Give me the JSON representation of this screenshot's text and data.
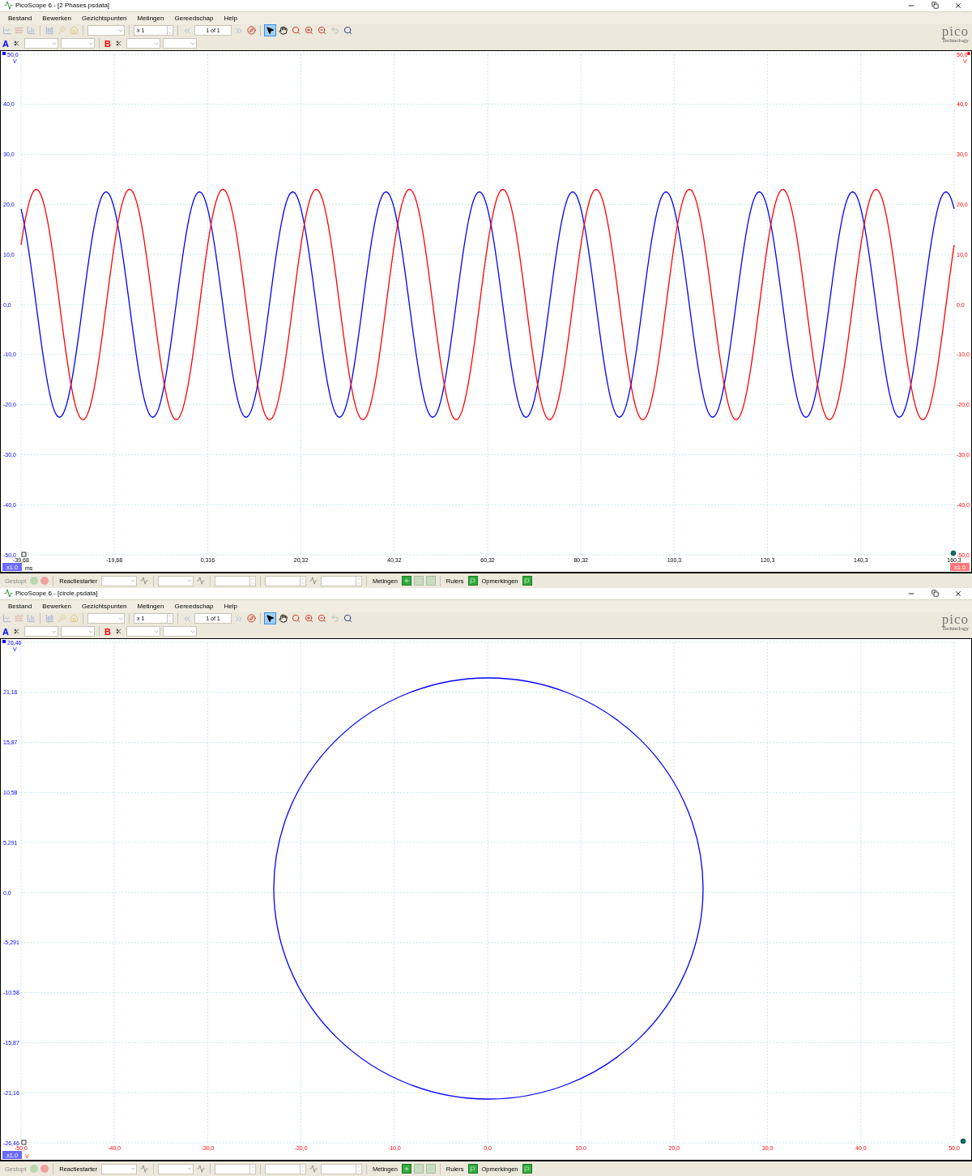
{
  "windows": [
    {
      "title": "PicoScope 6 - [2 Phases.psdata]",
      "menu": [
        "Bestand",
        "Bewerken",
        "Gezichtspunten",
        "Metingen",
        "Gereedschap",
        "Help"
      ],
      "toolbar": {
        "zoom": "x 1",
        "page": "1 of 1",
        "logo": "pico",
        "logo_sub": "Technology",
        "tools": [
          {
            "kind": "pointer",
            "selected": true
          },
          {
            "kind": "hand",
            "selected": false
          },
          {
            "kind": "zoom",
            "selected": false
          },
          {
            "kind": "zoom-in",
            "selected": false
          },
          {
            "kind": "zoom-out",
            "selected": false
          },
          {
            "kind": "undo",
            "selected": false
          },
          {
            "kind": "zoom-fit",
            "selected": false
          }
        ]
      },
      "channels": [
        {
          "label": "A",
          "color": "#0000ff"
        },
        {
          "label": "B",
          "color": "#ff0000"
        }
      ],
      "plot": {
        "kind": "time",
        "y_axis_left": {
          "unit": "V",
          "tag": "x1.0",
          "labels": [
            "50,0",
            "40,0",
            "30,0",
            "20,0",
            "10,0",
            "0,0",
            "-10,0",
            "-20,0",
            "-30,0",
            "-40,0",
            "-50,0"
          ]
        },
        "y_axis_right": {
          "unit": "V",
          "tag": "x1.0",
          "labels": [
            "50,0",
            "40,0",
            "30,0",
            "20,0",
            "10,0",
            "0,0",
            "-10,0",
            "-20,0",
            "-30,0",
            "-40,0",
            "-50,0"
          ]
        },
        "x_axis": {
          "unit": "ms",
          "labels": [
            "-39,68",
            "-19,68",
            "0,316",
            "20,32",
            "40,32",
            "60,32",
            "80,32",
            "100,3",
            "120,3",
            "140,3",
            "160,3"
          ]
        }
      },
      "status": {
        "state": "Gestopt",
        "trigger": "Reactiestarter",
        "measurements": "Metingen",
        "rulers": "Rulers",
        "notes": "Opmerkingen"
      }
    },
    {
      "title": "PicoScope 6 - [circle.psdata]",
      "menu": [
        "Bestand",
        "Bewerken",
        "Gezichtspunten",
        "Metingen",
        "Gereedschap",
        "Help"
      ],
      "toolbar": {
        "zoom": "x 1",
        "page": "1 of 1",
        "logo": "pico",
        "logo_sub": "Technology",
        "tools": [
          {
            "kind": "pointer",
            "selected": true
          },
          {
            "kind": "hand",
            "selected": false
          },
          {
            "kind": "zoom",
            "selected": false
          },
          {
            "kind": "zoom-in",
            "selected": false
          },
          {
            "kind": "zoom-out",
            "selected": false
          },
          {
            "kind": "undo",
            "selected": false
          },
          {
            "kind": "zoom-fit",
            "selected": false
          }
        ]
      },
      "channels": [
        {
          "label": "A",
          "color": "#0000ff"
        },
        {
          "label": "B",
          "color": "#ff0000"
        }
      ],
      "plot": {
        "kind": "xy",
        "y_axis_left": {
          "unit": "V",
          "tag": "x1.0",
          "labels": [
            "26,46",
            "21,16",
            "15,87",
            "10,58",
            "5,291",
            "0,0",
            "-5,291",
            "-10,58",
            "-15,87",
            "-21,16",
            "-26,46"
          ]
        },
        "x_axis": {
          "unit": "V",
          "labels": [
            "-50,0",
            "-40,0",
            "-30,0",
            "-20,0",
            "-10,0",
            "0,0",
            "10,0",
            "20,0",
            "30,0",
            "40,0",
            "50,0"
          ]
        }
      },
      "status": {
        "state": "Gestopt",
        "trigger": "Reactiestarter",
        "measurements": "Metingen",
        "rulers": "Rulers",
        "notes": "Opmerkingen"
      }
    }
  ]
}
